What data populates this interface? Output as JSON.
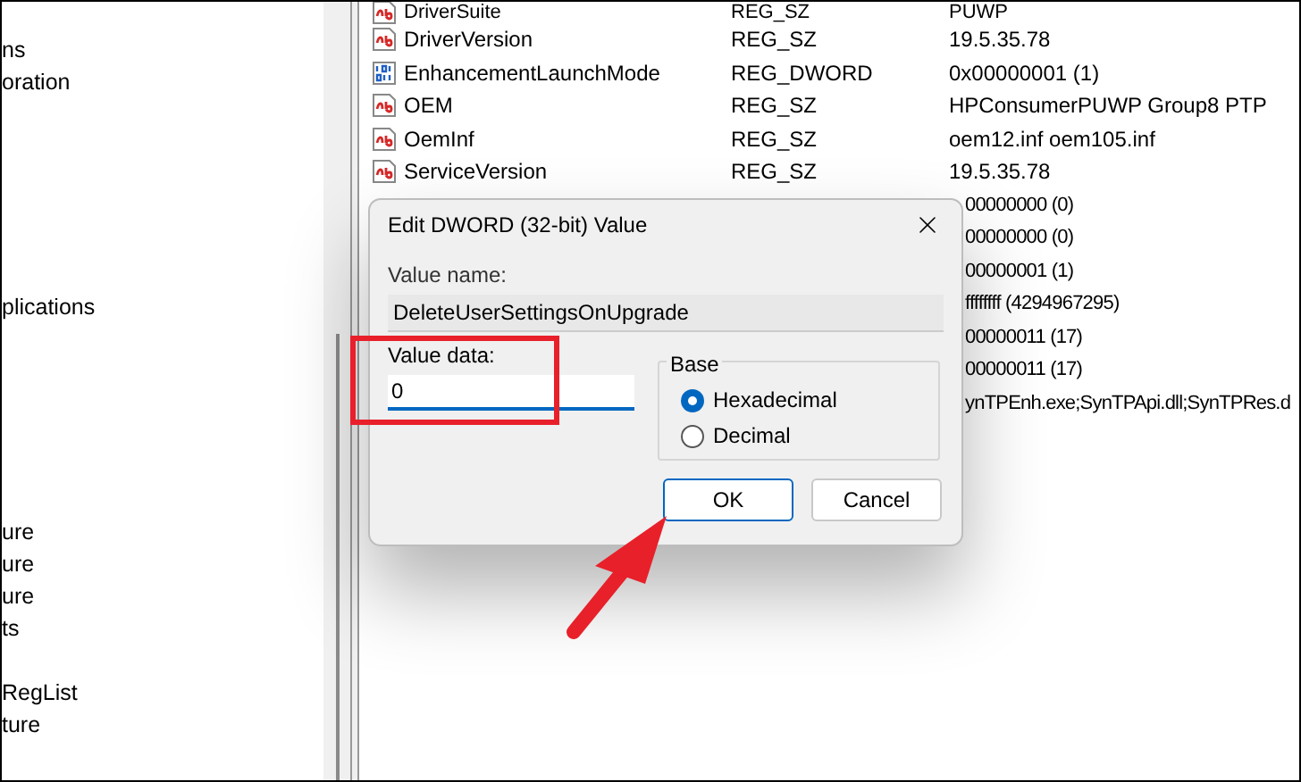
{
  "tree": {
    "items": [
      {
        "label": "ns"
      },
      {
        "label": "oration"
      },
      {
        "label": "plications"
      },
      {
        "label": "ure"
      },
      {
        "label": "ure"
      },
      {
        "label": "ure"
      },
      {
        "label": "ts"
      },
      {
        "label": "RegList"
      },
      {
        "label": "ture"
      }
    ]
  },
  "values": {
    "rows": [
      {
        "kind": "string",
        "name": "DriverSuite",
        "type": "REG_SZ",
        "data": "PUWP"
      },
      {
        "kind": "string",
        "name": "DriverVersion",
        "type": "REG_SZ",
        "data": "19.5.35.78"
      },
      {
        "kind": "dword",
        "name": "EnhancementLaunchMode",
        "type": "REG_DWORD",
        "data": "0x00000001 (1)"
      },
      {
        "kind": "string",
        "name": "OEM",
        "type": "REG_SZ",
        "data": "HPConsumerPUWP Group8 PTP"
      },
      {
        "kind": "string",
        "name": "OemInf",
        "type": "REG_SZ",
        "data": "oem12.inf oem105.inf"
      },
      {
        "kind": "string",
        "name": "ServiceVersion",
        "type": "REG_SZ",
        "data": "19.5.35.78"
      },
      {
        "kind": "covered",
        "data": "00000000 (0)"
      },
      {
        "kind": "covered",
        "data": "00000000 (0)"
      },
      {
        "kind": "covered",
        "data": "00000001 (1)"
      },
      {
        "kind": "covered",
        "data": "ffffffff (4294967295)"
      },
      {
        "kind": "covered",
        "data": "00000011 (17)"
      },
      {
        "kind": "covered",
        "data": "00000011 (17)"
      },
      {
        "kind": "covered",
        "data": "ynTPEnh.exe;SynTPApi.dll;SynTPRes.d"
      }
    ]
  },
  "dialog": {
    "title": "Edit DWORD (32-bit) Value",
    "value_name_label": "Value name:",
    "value_name": "DeleteUserSettingsOnUpgrade",
    "value_data_label": "Value data:",
    "value_data": "0",
    "base_label": "Base",
    "radios": [
      {
        "label": "Hexadecimal",
        "selected": true
      },
      {
        "label": "Decimal",
        "selected": false
      }
    ],
    "buttons": [
      {
        "label": "OK",
        "default": true
      },
      {
        "label": "Cancel",
        "default": false
      }
    ]
  }
}
